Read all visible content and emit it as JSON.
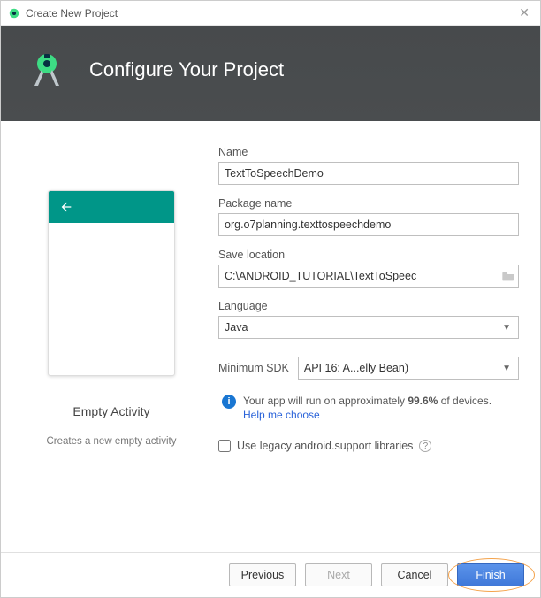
{
  "window": {
    "title": "Create New Project"
  },
  "banner": {
    "title": "Configure Your Project"
  },
  "template": {
    "name": "Empty Activity",
    "description": "Creates a new empty activity"
  },
  "fields": {
    "name": {
      "label": "Name",
      "value": "TextToSpeechDemo"
    },
    "package": {
      "label": "Package name",
      "value": "org.o7planning.texttospeechdemo"
    },
    "location": {
      "label": "Save location",
      "value": "C:\\ANDROID_TUTORIAL\\TextToSpeec"
    },
    "language": {
      "label": "Language",
      "value": "Java"
    },
    "minsdk": {
      "label": "Minimum SDK",
      "value": "API 16: A...elly Bean)"
    }
  },
  "info": {
    "line1": "Your app will run on approximately ",
    "percent": "99.6%",
    "line1b": " of devices.",
    "link": "Help me choose"
  },
  "legacy": {
    "label": "Use legacy android.support libraries"
  },
  "buttons": {
    "previous": "Previous",
    "next": "Next",
    "cancel": "Cancel",
    "finish": "Finish"
  }
}
